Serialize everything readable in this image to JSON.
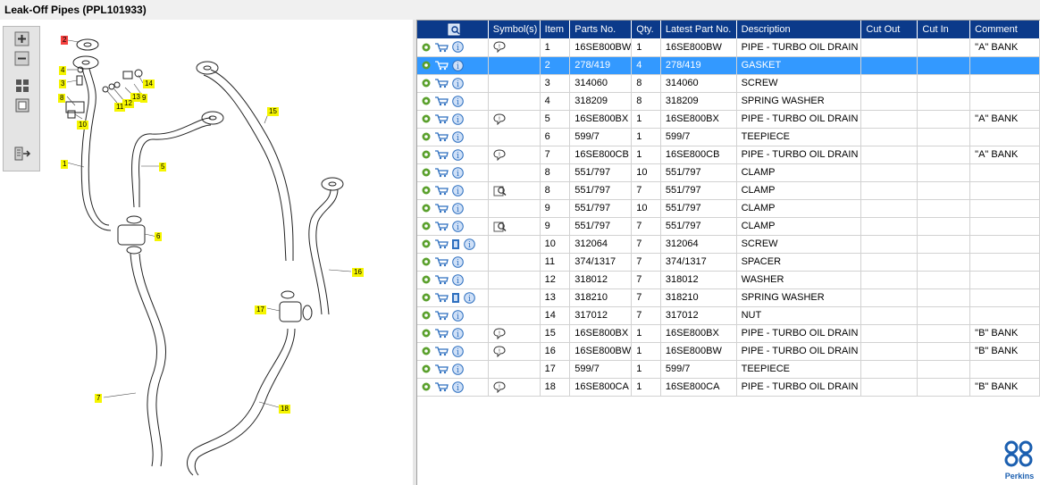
{
  "window": {
    "title": "Leak-Off Pipes (PPL101933)"
  },
  "toolbar": {
    "buttons": [
      "zoom-in-icon",
      "zoom-out-icon",
      "fit-all-icon",
      "fit-window-icon",
      "export-icon"
    ]
  },
  "diagram": {
    "callouts": [
      {
        "label": "2",
        "color": "#f4413f"
      },
      {
        "label": "4"
      },
      {
        "label": "3"
      },
      {
        "label": "8"
      },
      {
        "label": "10"
      },
      {
        "label": "14"
      },
      {
        "label": "13"
      },
      {
        "label": "9"
      },
      {
        "label": "11"
      },
      {
        "label": "12"
      },
      {
        "label": "1"
      },
      {
        "label": "5"
      },
      {
        "label": "15"
      },
      {
        "label": "6"
      },
      {
        "label": "16"
      },
      {
        "label": "17"
      },
      {
        "label": "7"
      },
      {
        "label": "18"
      }
    ]
  },
  "table": {
    "columns": [
      "",
      "Symbol(s)",
      "Item",
      "Parts No.",
      "Qty.",
      "Latest Part No.",
      "Description",
      "Cut Out",
      "Cut In",
      "Comment"
    ],
    "rows": [
      {
        "symbol": "comment",
        "item": "1",
        "part": "16SE800BW",
        "qty": "1",
        "latest": "16SE800BW",
        "desc": "PIPE - TURBO OIL DRAIN",
        "cutout": "",
        "cutin": "",
        "comment": "\"A\" BANK"
      },
      {
        "symbol": "",
        "item": "2",
        "part": "278/419",
        "qty": "4",
        "latest": "278/419",
        "desc": "GASKET",
        "cutout": "",
        "cutin": "",
        "comment": "",
        "selected": true
      },
      {
        "symbol": "",
        "item": "3",
        "part": "314060",
        "qty": "8",
        "latest": "314060",
        "desc": "SCREW",
        "cutout": "",
        "cutin": "",
        "comment": ""
      },
      {
        "symbol": "",
        "item": "4",
        "part": "318209",
        "qty": "8",
        "latest": "318209",
        "desc": "SPRING WASHER",
        "cutout": "",
        "cutin": "",
        "comment": ""
      },
      {
        "symbol": "comment",
        "item": "5",
        "part": "16SE800BX",
        "qty": "1",
        "latest": "16SE800BX",
        "desc": "PIPE - TURBO OIL DRAIN",
        "cutout": "",
        "cutin": "",
        "comment": "\"A\" BANK"
      },
      {
        "symbol": "",
        "item": "6",
        "part": "599/7",
        "qty": "1",
        "latest": "599/7",
        "desc": "TEEPIECE",
        "cutout": "",
        "cutin": "",
        "comment": ""
      },
      {
        "symbol": "comment",
        "item": "7",
        "part": "16SE800CB",
        "qty": "1",
        "latest": "16SE800CB",
        "desc": "PIPE - TURBO OIL DRAIN",
        "cutout": "",
        "cutin": "",
        "comment": "\"A\" BANK"
      },
      {
        "symbol": "",
        "item": "8",
        "part": "551/797",
        "qty": "10",
        "latest": "551/797",
        "desc": "CLAMP",
        "cutout": "",
        "cutin": "",
        "comment": ""
      },
      {
        "symbol": "view",
        "item": "8",
        "part": "551/797",
        "qty": "7",
        "latest": "551/797",
        "desc": "CLAMP",
        "cutout": "",
        "cutin": "",
        "comment": ""
      },
      {
        "symbol": "",
        "item": "9",
        "part": "551/797",
        "qty": "10",
        "latest": "551/797",
        "desc": "CLAMP",
        "cutout": "",
        "cutin": "",
        "comment": ""
      },
      {
        "symbol": "view",
        "item": "9",
        "part": "551/797",
        "qty": "7",
        "latest": "551/797",
        "desc": "CLAMP",
        "cutout": "",
        "cutin": "",
        "comment": ""
      },
      {
        "symbol": "",
        "item": "10",
        "part": "312064",
        "qty": "7",
        "latest": "312064",
        "desc": "SCREW",
        "cutout": "",
        "cutin": "",
        "comment": "",
        "extra": true
      },
      {
        "symbol": "",
        "item": "11",
        "part": "374/1317",
        "qty": "7",
        "latest": "374/1317",
        "desc": "SPACER",
        "cutout": "",
        "cutin": "",
        "comment": ""
      },
      {
        "symbol": "",
        "item": "12",
        "part": "318012",
        "qty": "7",
        "latest": "318012",
        "desc": "WASHER",
        "cutout": "",
        "cutin": "",
        "comment": ""
      },
      {
        "symbol": "",
        "item": "13",
        "part": "318210",
        "qty": "7",
        "latest": "318210",
        "desc": "SPRING WASHER",
        "cutout": "",
        "cutin": "",
        "comment": "",
        "extra": true
      },
      {
        "symbol": "",
        "item": "14",
        "part": "317012",
        "qty": "7",
        "latest": "317012",
        "desc": "NUT",
        "cutout": "",
        "cutin": "",
        "comment": ""
      },
      {
        "symbol": "comment",
        "item": "15",
        "part": "16SE800BX",
        "qty": "1",
        "latest": "16SE800BX",
        "desc": "PIPE - TURBO OIL DRAIN",
        "cutout": "",
        "cutin": "",
        "comment": "\"B\" BANK"
      },
      {
        "symbol": "comment",
        "item": "16",
        "part": "16SE800BW",
        "qty": "1",
        "latest": "16SE800BW",
        "desc": "PIPE - TURBO OIL DRAIN",
        "cutout": "",
        "cutin": "",
        "comment": "\"B\" BANK"
      },
      {
        "symbol": "",
        "item": "17",
        "part": "599/7",
        "qty": "1",
        "latest": "599/7",
        "desc": "TEEPIECE",
        "cutout": "",
        "cutin": "",
        "comment": ""
      },
      {
        "symbol": "comment",
        "item": "18",
        "part": "16SE800CA",
        "qty": "1",
        "latest": "16SE800CA",
        "desc": "PIPE - TURBO OIL DRAIN",
        "cutout": "",
        "cutin": "",
        "comment": "\"B\" BANK"
      }
    ]
  },
  "brand": {
    "name": "Perkins",
    "color": "#1b5fb0"
  },
  "colors": {
    "header": "#0b3a8a",
    "selection": "#3399ff",
    "callout": "#f5f500",
    "callout_selected": "#f4413f"
  }
}
